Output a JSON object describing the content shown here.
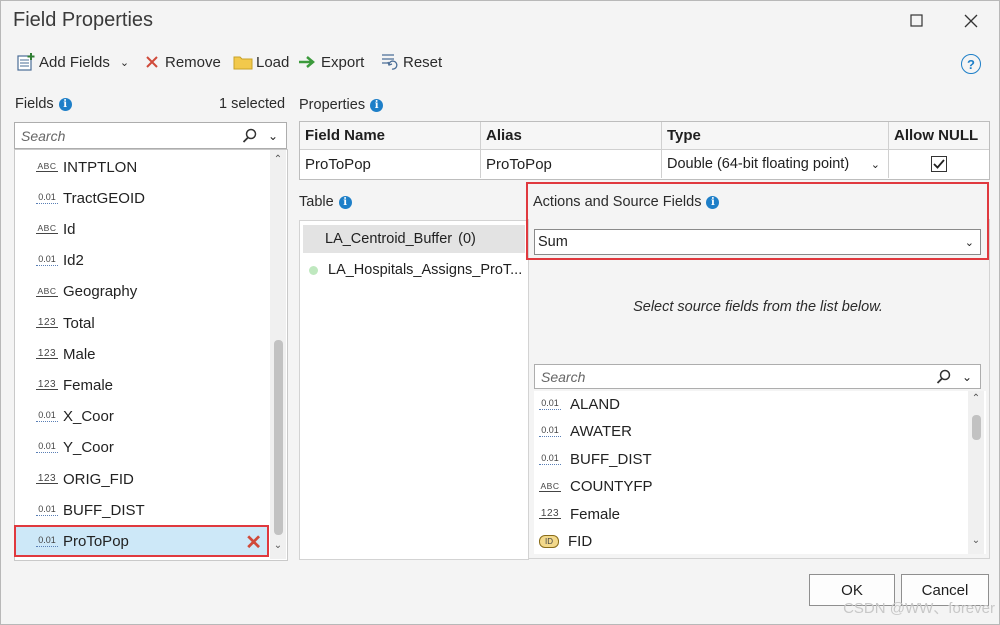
{
  "window": {
    "title": "Field Properties"
  },
  "toolbar": {
    "add_fields": "Add Fields",
    "remove": "Remove",
    "load": "Load",
    "export": "Export",
    "reset": "Reset",
    "help": "?"
  },
  "fields_panel": {
    "label": "Fields",
    "selected_count": "1 selected",
    "search_placeholder": "Search",
    "items": [
      {
        "type": "ABC",
        "name": "INTPTLON"
      },
      {
        "type": "0.01",
        "name": "TractGEOID"
      },
      {
        "type": "ABC",
        "name": "Id"
      },
      {
        "type": "0.01",
        "name": "Id2"
      },
      {
        "type": "ABC",
        "name": "Geography"
      },
      {
        "type": "123",
        "name": "Total"
      },
      {
        "type": "123",
        "name": "Male"
      },
      {
        "type": "123",
        "name": "Female"
      },
      {
        "type": "0.01",
        "name": "X_Coor"
      },
      {
        "type": "0.01",
        "name": "Y_Coor"
      },
      {
        "type": "123",
        "name": "ORIG_FID"
      },
      {
        "type": "0.01",
        "name": "BUFF_DIST"
      },
      {
        "type": "0.01",
        "name": "ProToPop"
      }
    ]
  },
  "properties": {
    "label": "Properties",
    "headers": [
      "Field Name",
      "Alias",
      "Type",
      "Allow NULL"
    ],
    "row": {
      "field_name": "ProToPop",
      "alias": "ProToPop",
      "type": "Double (64-bit floating point)",
      "allow_null": true
    }
  },
  "table": {
    "label": "Table",
    "items": [
      {
        "name": "LA_Centroid_Buffer",
        "count": "(0)"
      },
      {
        "name": "LA_Hospitals_Assigns_ProT..."
      }
    ]
  },
  "actions": {
    "label": "Actions and Source Fields",
    "selected_action": "Sum",
    "hint": "Select source fields from the list below.",
    "search_placeholder": "Search",
    "source_fields": [
      {
        "type": "0.01",
        "name": "ALAND"
      },
      {
        "type": "0.01",
        "name": "AWATER"
      },
      {
        "type": "0.01",
        "name": "BUFF_DIST"
      },
      {
        "type": "ABC",
        "name": "COUNTYFP"
      },
      {
        "type": "123",
        "name": "Female"
      },
      {
        "type": "ID",
        "name": "FID"
      }
    ]
  },
  "buttons": {
    "ok": "OK",
    "cancel": "Cancel"
  },
  "watermark": "CSDN @WW、forever",
  "colors": {
    "accent": "#1e7fc8",
    "highlight": "#e0393e",
    "selected_row": "#cde8f8"
  }
}
